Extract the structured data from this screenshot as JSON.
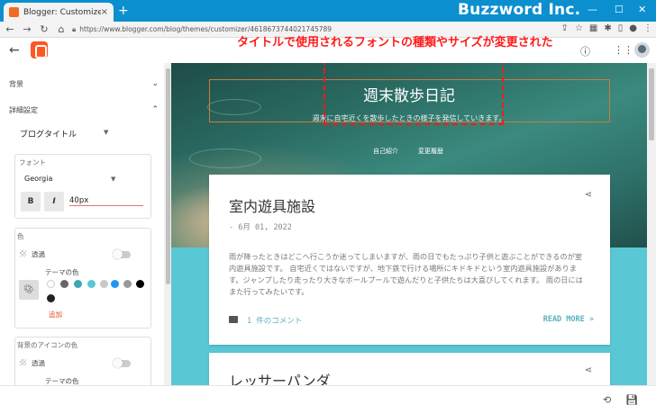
{
  "browser": {
    "tab_title": "Blogger: Customizer",
    "tab_close": "×",
    "new_tab": "+",
    "brand": "Buzzword Inc.",
    "url": "https://www.blogger.com/blog/themes/customizer/4618673744021745789",
    "controls": {
      "minimize": "—",
      "maximize": "☐",
      "close": "✕"
    }
  },
  "annotation": {
    "text": "タイトルで使用されるフォントの種類やサイズが変更された",
    "color": "#ff1a1a"
  },
  "sidebar": {
    "background_section": "背景",
    "advanced_section": "詳細設定",
    "dropdown_value": "ブログタイトル",
    "font_card": {
      "label": "フォント",
      "font_family": "Georgia",
      "bold_label": "B",
      "italic_label": "I",
      "size_value": "40px"
    },
    "color_card": {
      "label": "色",
      "transparent_label": "透過",
      "theme_colors_label": "テーマの色",
      "add_label": "追加",
      "swatches": [
        "#ffffff",
        "#666666",
        "#3aa7b4",
        "#59c7d4",
        "#c8c8c8",
        "#2196f3",
        "#999999",
        "#000000",
        "#222222"
      ]
    },
    "icon_color_card": {
      "label": "背景のアイコンの色",
      "transparent_label": "透過",
      "theme_colors_label": "テーマの色"
    }
  },
  "preview": {
    "blog_title": "週末散歩日記",
    "blog_description": "週末に自宅近くを散歩したときの様子を発信していきます。",
    "menu": [
      "自己紹介",
      "変更履歴"
    ],
    "posts": [
      {
        "title": "室内遊具施設",
        "date": "- 6月 01, 2022",
        "body": "雨が降ったときはどこへ行こうか迷ってしまいますが、雨の日でもたっぷり子供と遊ぶことができるのが室内遊具施設です。 自宅近くではないですが、地下鉄で行ける場所にキドキドという室内遊具施設があります。ジャンプしたり走ったり大きなボールプールで遊んだりと子供たちは大喜びしてくれます。 雨の日にはまた行ってみたいです。",
        "comments": "1 件のコメント",
        "read_more": "READ MORE »"
      },
      {
        "title": "レッサーパンダ"
      }
    ]
  }
}
